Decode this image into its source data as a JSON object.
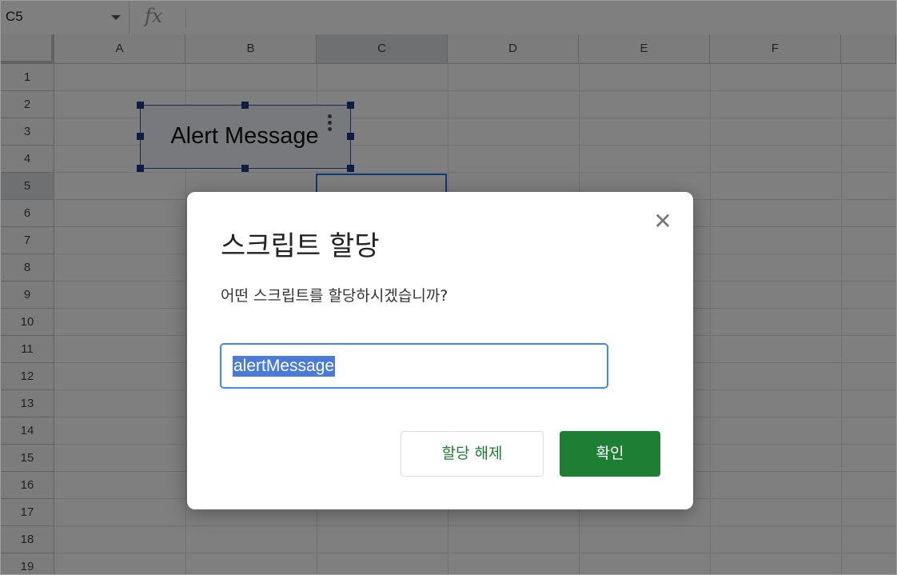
{
  "formula_bar": {
    "name_box": "C5",
    "fx_label": "fx"
  },
  "sheet": {
    "columns": [
      "A",
      "B",
      "C",
      "D",
      "E",
      "F"
    ],
    "selected_column": "C",
    "rows": [
      "1",
      "2",
      "3",
      "4",
      "5",
      "6",
      "7",
      "8",
      "9",
      "10",
      "11",
      "12",
      "13",
      "14",
      "15",
      "16",
      "17",
      "18",
      "19"
    ],
    "selected_row": "5"
  },
  "drawing": {
    "text": "Alert Message"
  },
  "dialog": {
    "title": "스크립트 할당",
    "close_glyph": "✕",
    "prompt": "어떤 스크립트를 할당하시겠습니까?",
    "input_value": "alertMessage",
    "unassign_label": "할당 해제",
    "ok_label": "확인"
  },
  "colors": {
    "primary_green": "#1e7e34",
    "focus_blue": "#4285f4",
    "selection_highlight": "#4a7bd9"
  }
}
